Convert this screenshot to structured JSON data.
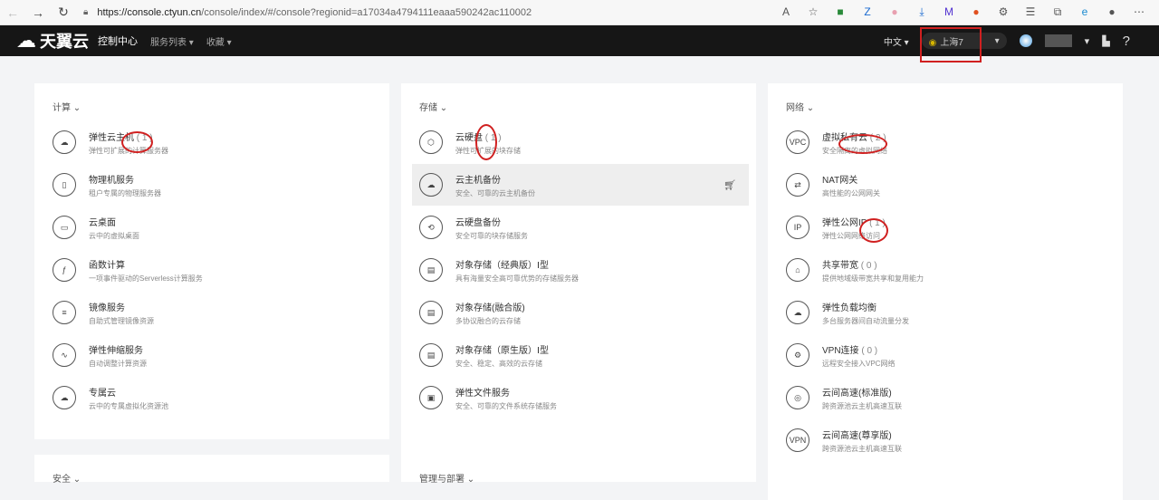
{
  "browser": {
    "url_host": "https://console.ctyun.cn",
    "url_path": "/console/index/#/console?regionid=a17034a4794111eaaa590242ac110002"
  },
  "header": {
    "brand": "天翼云",
    "console": "控制中心",
    "menus": [
      "服务列表 ▾",
      "收藏 ▾"
    ],
    "language": "中文 ▾",
    "region": "上海7",
    "help": "?"
  },
  "cards": [
    {
      "title": "计算 ⌄",
      "items": [
        {
          "name": "弹性云主机",
          "count": "( 1 )",
          "desc": "弹性可扩展的计算服务器",
          "icon": "☁"
        },
        {
          "name": "物理机服务",
          "count": "",
          "desc": "租户专属的物理服务器",
          "icon": "▯"
        },
        {
          "name": "云桌面",
          "count": "",
          "desc": "云中的虚拟桌面",
          "icon": "▭"
        },
        {
          "name": "函数计算",
          "count": "",
          "desc": "一项事件驱动的Serverless计算服务",
          "icon": "ƒ"
        },
        {
          "name": "镜像服务",
          "count": "",
          "desc": "自助式管理镜像资源",
          "icon": "≡"
        },
        {
          "name": "弹性伸缩服务",
          "count": "",
          "desc": "自动调整计算资源",
          "icon": "∿"
        },
        {
          "name": "专属云",
          "count": "",
          "desc": "云中的专属虚拟化资源池",
          "icon": "☁"
        }
      ]
    },
    {
      "title": "存储 ⌄",
      "items": [
        {
          "name": "云硬盘",
          "count": "( 1 )",
          "desc": "弹性可扩展的块存储",
          "icon": "⬡"
        },
        {
          "name": "云主机备份",
          "count": "",
          "desc": "安全、可靠的云主机备份",
          "icon": "☁"
        },
        {
          "name": "云硬盘备份",
          "count": "",
          "desc": "安全可靠的块存储服务",
          "icon": "⟲"
        },
        {
          "name": "对象存储（经典版）Ⅰ型",
          "count": "",
          "desc": "具有海量安全高可靠优势的存储服务器",
          "icon": "▤"
        },
        {
          "name": "对象存储(融合版)",
          "count": "",
          "desc": "多协议融合的云存储",
          "icon": "▤"
        },
        {
          "name": "对象存储（原生版）Ⅰ型",
          "count": "",
          "desc": "安全、稳定、高效的云存储",
          "icon": "▤"
        },
        {
          "name": "弹性文件服务",
          "count": "",
          "desc": "安全、可靠的文件系统存储服务",
          "icon": "▣"
        }
      ]
    },
    {
      "title": "网络 ⌄",
      "items": [
        {
          "name": "虚拟私有云",
          "count": "( 2 )",
          "desc": "安全隔离的虚拟网络",
          "icon": "VPC"
        },
        {
          "name": "NAT网关",
          "count": "",
          "desc": "高性能的公网网关",
          "icon": "⇄"
        },
        {
          "name": "弹性公网IP",
          "count": "( 1 )",
          "desc": "弹性公网网络访问",
          "icon": "IP"
        },
        {
          "name": "共享带宽",
          "count": "( 0 )",
          "desc": "提供地域级带宽共享和复用能力",
          "icon": "⌂"
        },
        {
          "name": "弹性负载均衡",
          "count": "",
          "desc": "多台服务器间自动流量分发",
          "icon": "☁"
        },
        {
          "name": "VPN连接",
          "count": "( 0 )",
          "desc": "远程安全接入VPC网络",
          "icon": "⚙"
        },
        {
          "name": "云间高速(标准版)",
          "count": "",
          "desc": "跨资源池云主机高速互联",
          "icon": "◎"
        },
        {
          "name": "云间高速(尊享版)",
          "count": "",
          "desc": "跨资源池云主机高速互联",
          "icon": "VPN"
        }
      ]
    }
  ],
  "bottom_cards": [
    "安全 ⌄",
    "管理与部署 ⌄"
  ]
}
